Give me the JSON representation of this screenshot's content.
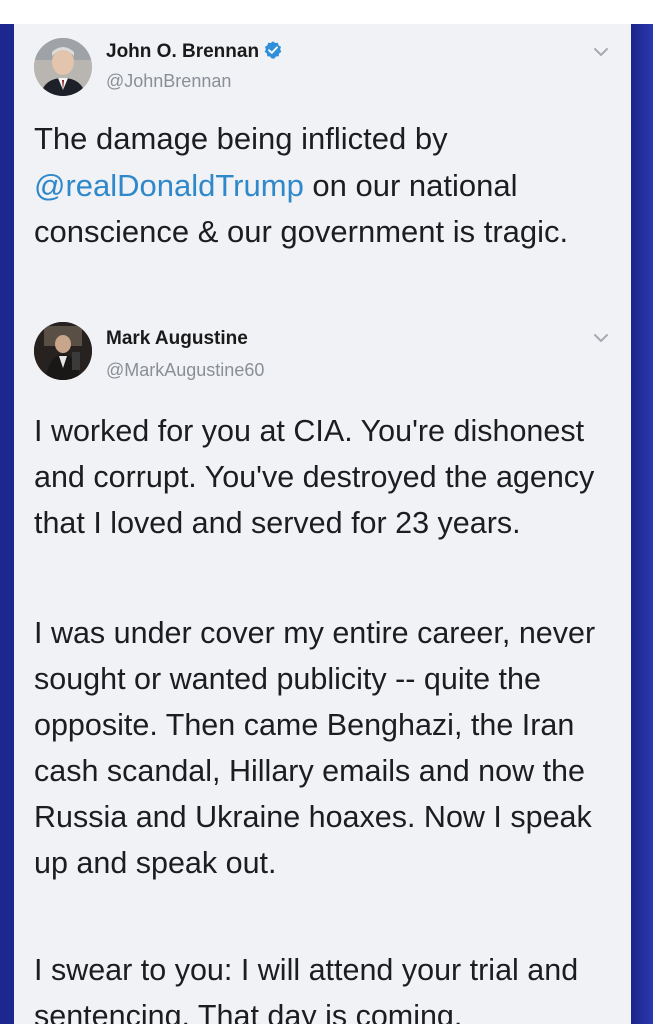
{
  "tweets": [
    {
      "display_name": "John O. Brennan",
      "handle": "@JohnBrennan",
      "verified": true,
      "text_before": "The damage being inflicted by ",
      "mention": "@realDonaldTrump",
      "text_after": " on our national conscience & our government is tragic."
    },
    {
      "display_name": "Mark Augustine",
      "handle": "@MarkAugustine60",
      "verified": false,
      "paragraphs": [
        "I worked for you at CIA.  You're dishonest and corrupt.  You've destroyed the agency that I loved and served for 23 years.",
        "I was under cover my entire career, never sought or wanted publicity -- quite the opposite.  Then came Benghazi, the Iran cash scandal, Hillary emails and now the Russia and Ukraine hoaxes.  Now I speak up and speak out.",
        "I swear to you: I will attend your trial and sentencing.  That day is coming."
      ]
    }
  ],
  "icons": {
    "verified": "verified-badge-icon",
    "menu": "chevron-down-icon",
    "avatar": "avatar"
  },
  "colors": {
    "mention": "#2f88c9",
    "verified": "#2f8fd8",
    "frame_blue": "#1c2890"
  }
}
